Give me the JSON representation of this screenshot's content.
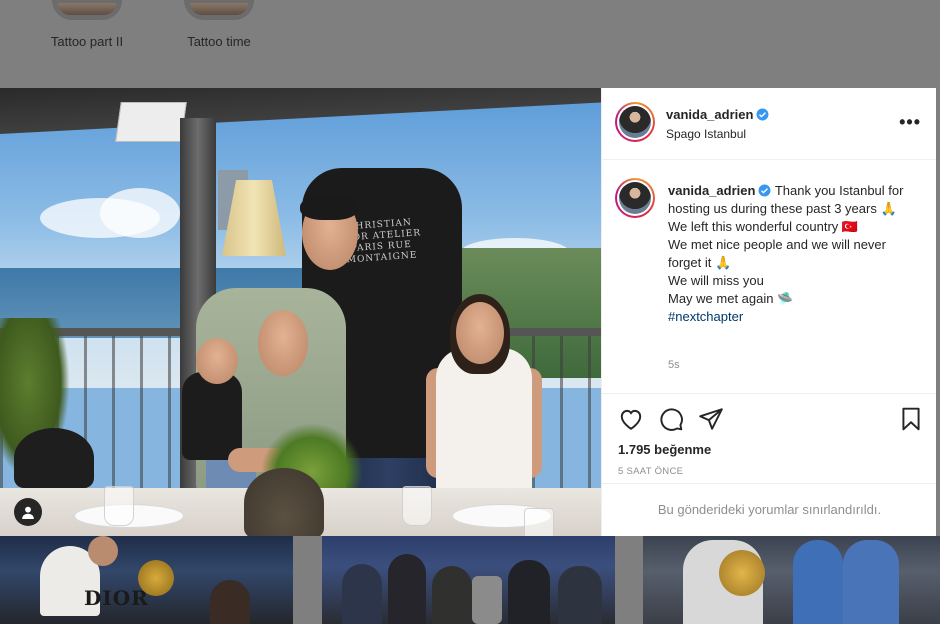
{
  "highlights": [
    {
      "label": "Tattoo part II"
    },
    {
      "label": "Tattoo time"
    }
  ],
  "post": {
    "username": "vanida_adrien",
    "location": "Spago Istanbul",
    "more_icon": "more-horizontal-icon",
    "caption_lines": [
      "Thank you Istanbul for hosting us during these past 3 years 🙏",
      "We left this wonderful country 🇹🇷",
      "We met nice people and we will never forget it 🙏",
      "We will miss you",
      "May we met again 🛸"
    ],
    "hashtag": "#nextchapter",
    "caption_age": "5s",
    "likes": "1.795 beğenme",
    "posted_ago": "5 SAAT ÖNCE",
    "comments_limited": "Bu gönderideki yorumlar sınırlandırıldı.",
    "shirt_print": "CHRISTIAN DIOR ATELIER PARIS RUE MONTAIGNE",
    "actions": [
      "heart-icon",
      "comment-icon",
      "share-icon",
      "bookmark-icon"
    ]
  },
  "grid": {
    "thumb1_text": "DIOR"
  },
  "colors": {
    "link": "#00376b",
    "verified": "#3897f0",
    "secondary_text": "#8e8e8e"
  }
}
